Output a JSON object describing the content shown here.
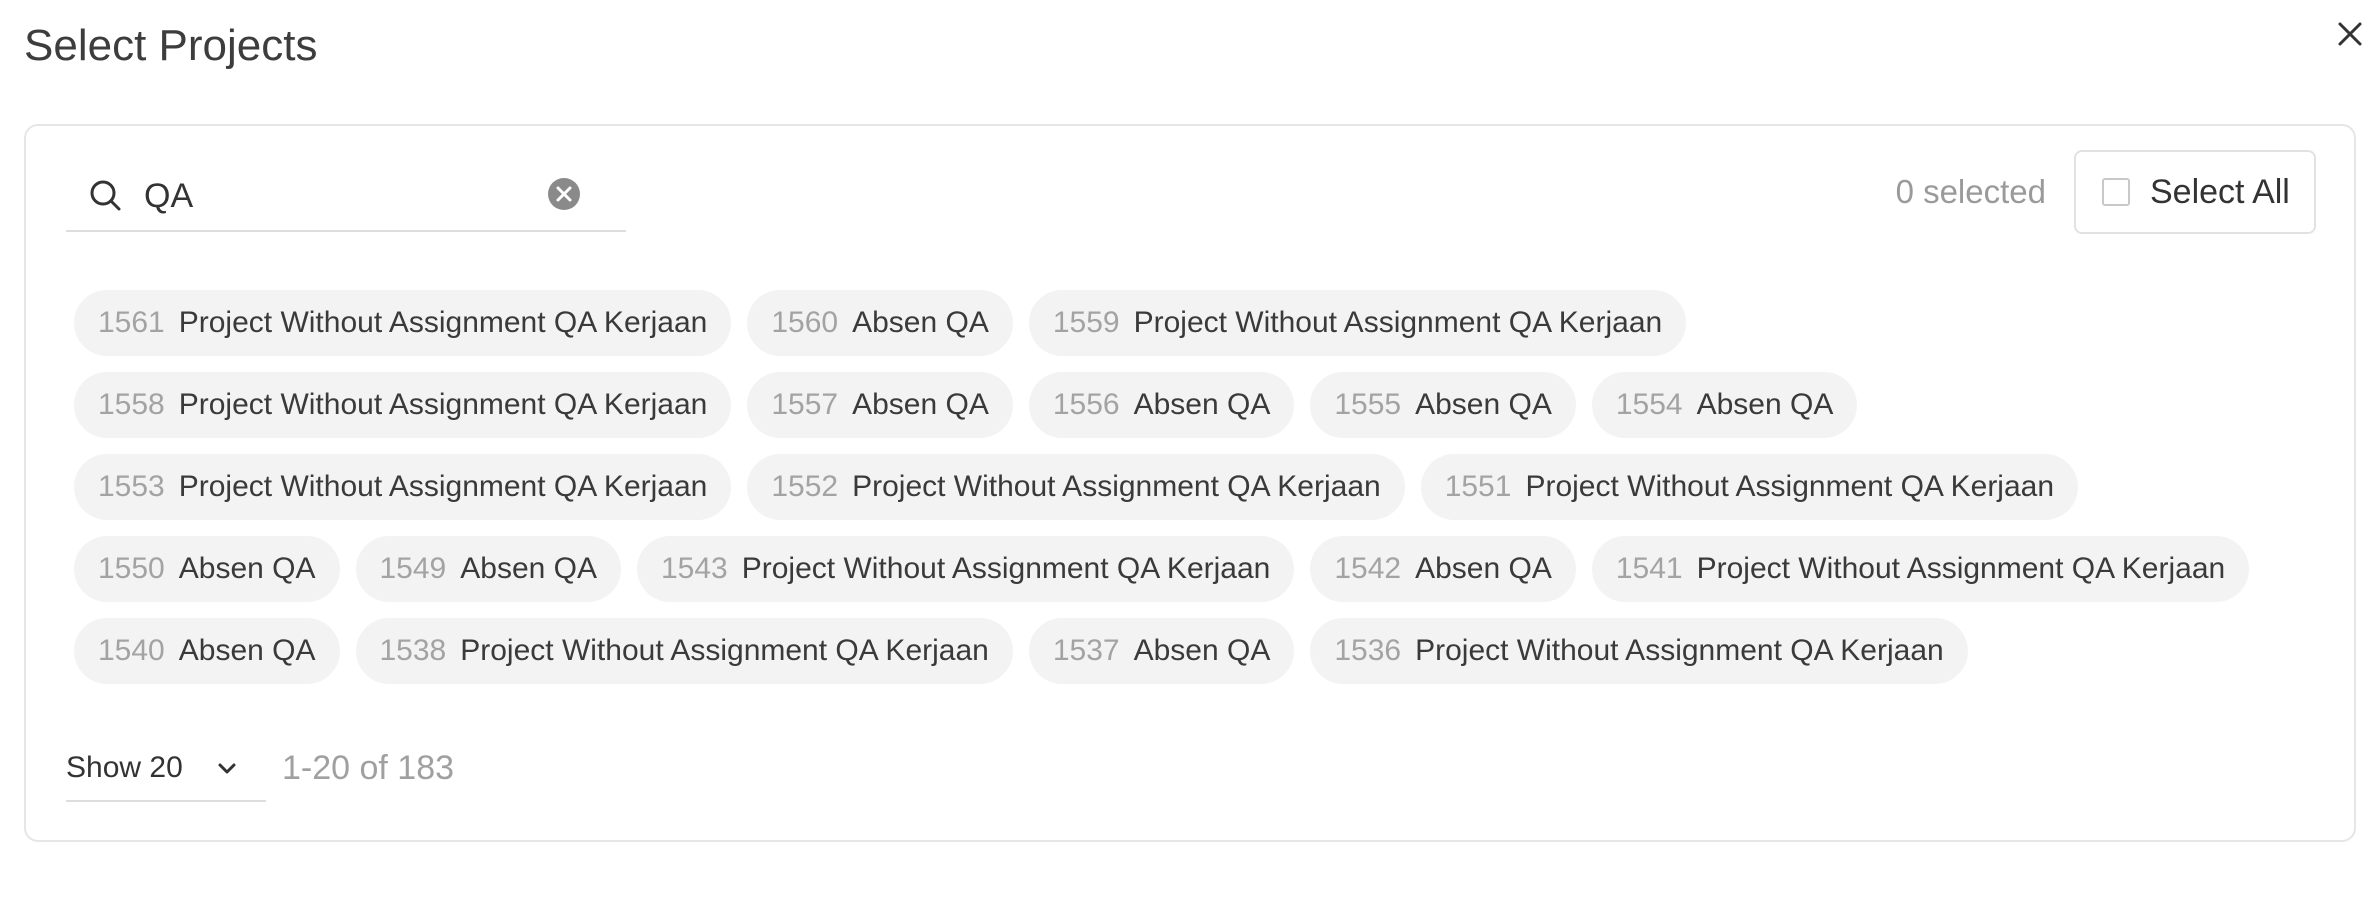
{
  "dialog": {
    "title": "Select Projects",
    "close_icon": "close-icon"
  },
  "search": {
    "icon": "search-icon",
    "value": "QA",
    "clear_icon": "clear-circle-icon"
  },
  "selection": {
    "count_text": "0 selected",
    "select_all_label": "Select All",
    "select_all_checked": false
  },
  "projects": [
    {
      "id": "1561",
      "name": "Project Without Assignment QA Kerjaan"
    },
    {
      "id": "1560",
      "name": "Absen QA"
    },
    {
      "id": "1559",
      "name": "Project Without Assignment QA Kerjaan"
    },
    {
      "id": "1558",
      "name": "Project Without Assignment QA Kerjaan"
    },
    {
      "id": "1557",
      "name": "Absen QA"
    },
    {
      "id": "1556",
      "name": "Absen QA"
    },
    {
      "id": "1555",
      "name": "Absen QA"
    },
    {
      "id": "1554",
      "name": "Absen QA"
    },
    {
      "id": "1553",
      "name": "Project Without Assignment QA Kerjaan"
    },
    {
      "id": "1552",
      "name": "Project Without Assignment QA Kerjaan"
    },
    {
      "id": "1551",
      "name": "Project Without Assignment QA Kerjaan"
    },
    {
      "id": "1550",
      "name": "Absen QA"
    },
    {
      "id": "1549",
      "name": "Absen QA"
    },
    {
      "id": "1543",
      "name": "Project Without Assignment QA Kerjaan"
    },
    {
      "id": "1542",
      "name": "Absen QA"
    },
    {
      "id": "1541",
      "name": "Project Without Assignment QA Kerjaan"
    },
    {
      "id": "1540",
      "name": "Absen QA"
    },
    {
      "id": "1538",
      "name": "Project Without Assignment QA Kerjaan"
    },
    {
      "id": "1537",
      "name": "Absen QA"
    },
    {
      "id": "1536",
      "name": "Project Without Assignment QA Kerjaan"
    }
  ],
  "pagination": {
    "page_size_label": "Show 20",
    "chevron_icon": "chevron-down-icon",
    "range_text": "1-20 of 183"
  },
  "colors": {
    "chip_background": "#f3f3f3",
    "chip_id_text": "#a3a3a3",
    "muted_text": "#9a9a9a",
    "border": "#e6e6e6"
  }
}
